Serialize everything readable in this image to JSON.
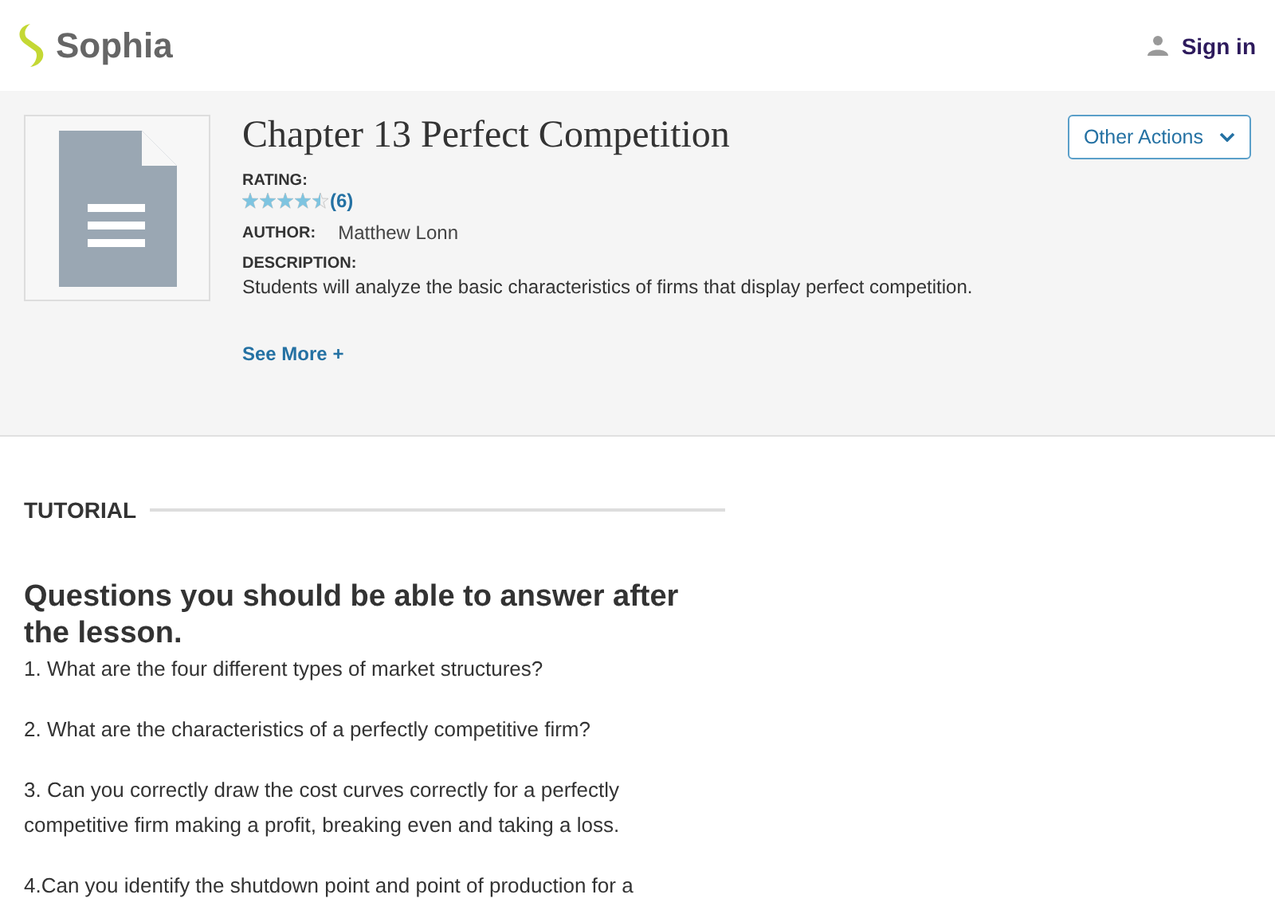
{
  "header": {
    "logo": "Sophia",
    "sign_in": "Sign in"
  },
  "resource": {
    "title": "Chapter 13 Perfect Competition",
    "action_button": "Other Actions",
    "rating_label": "RATING:",
    "stars": 4.5,
    "rating_count": "(6)",
    "author_label": "AUTHOR:",
    "author": "Matthew Lonn",
    "description_label": "DESCRIPTION:",
    "description": "Students will analyze the basic characteristics of firms that display perfect competition.",
    "see_more": "See More +"
  },
  "tutorial": {
    "section_label": "TUTORIAL",
    "heading": "Questions you should be able to answer after the lesson.",
    "questions": [
      "1. What are the four different types of market structures?",
      "2. What are the characteristics of a perfectly competitive firm?",
      "3. Can you correctly draw the cost curves correctly for a perfectly competitive firm making a profit, breaking even and taking a loss.",
      "4.Can you identify the shutdown point and point of production for a"
    ]
  }
}
